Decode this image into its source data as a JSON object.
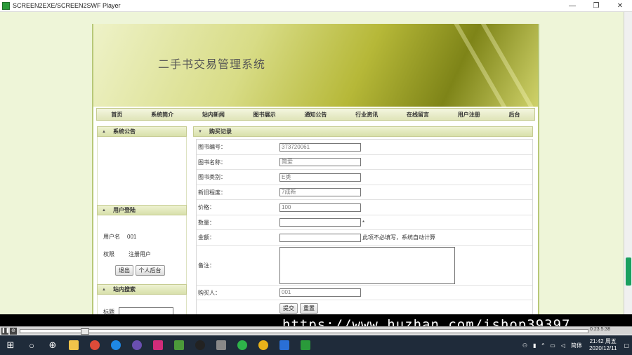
{
  "window": {
    "title": "SCREEN2EXE/SCREEN2SWF Player",
    "minimize": "—",
    "maximize": "❐",
    "close": "✕"
  },
  "site": {
    "title": "二手书交易管理系统",
    "nav": [
      "首页",
      "系统简介",
      "站内新闻",
      "图书展示",
      "通知公告",
      "行业资讯",
      "在线留言",
      "用户注册",
      "后台"
    ]
  },
  "sidebar": {
    "announcement_header": "系统公告",
    "login_header": "用户登陆",
    "username_label": "用户名",
    "username_value": "001",
    "role_label": "权限",
    "role_value": "注册用户",
    "logout_btn": "退出",
    "personal_btn": "个人后台",
    "search_header": "站内搜索",
    "search_title_label": "标题"
  },
  "form": {
    "header": "购买记录",
    "rows": [
      {
        "label": "图书编号：",
        "value": "373720061"
      },
      {
        "label": "图书名称：",
        "value": "简爱"
      },
      {
        "label": "图书类别：",
        "value": "E类"
      },
      {
        "label": "新旧程度：",
        "value": "7成新"
      },
      {
        "label": "价格：",
        "value": "100"
      }
    ],
    "qty_label": "数量：",
    "qty_required": "*",
    "amount_label": "金额：",
    "amount_note": "此项不必填写，系统自动计算",
    "remark_label": "备注：",
    "buyer_label": "购买人：",
    "buyer_value": "001",
    "submit_btn": "提交",
    "reset_btn": "重置"
  },
  "watermark": "https://www.huzhan.com/ishop39397",
  "player": {
    "time": "0:23:5:38"
  },
  "taskbar": {
    "ime": "简体",
    "time": "21:42 周五",
    "date": "2020/12/11"
  }
}
